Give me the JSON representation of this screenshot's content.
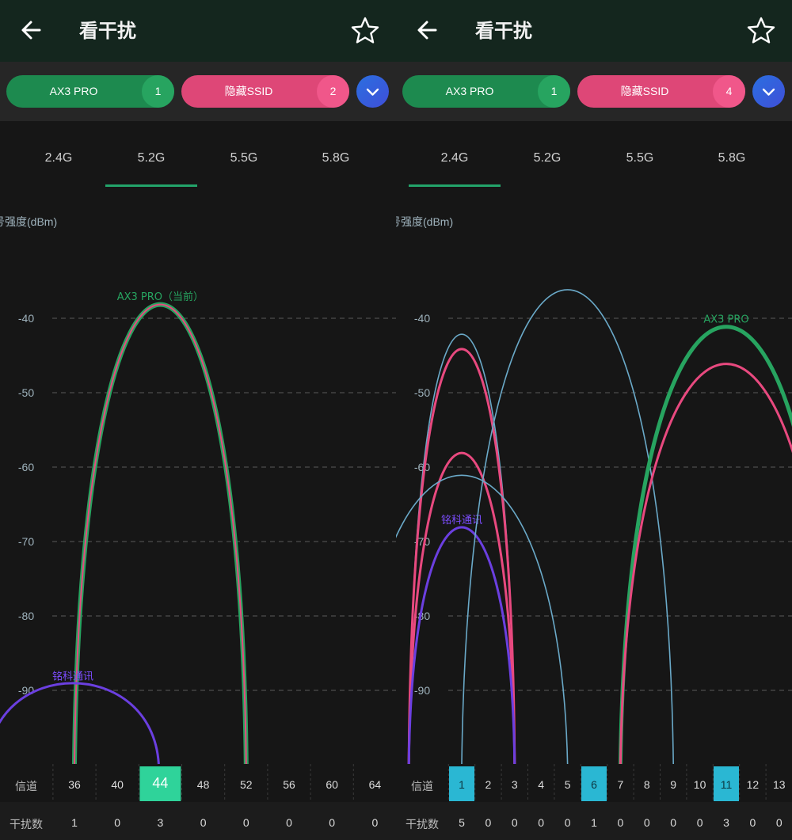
{
  "colors": {
    "header_bg": "#14261e",
    "green": "#1d8a4f",
    "pink": "#de4777",
    "blue_curve": "#6aa9c8",
    "purple": "#6b3fe0",
    "selected_channel_bg": "#2fd39a",
    "highlight_channel_bg": "#2ab7d3"
  },
  "panels": [
    {
      "header": {
        "title": "看干扰"
      },
      "chips": [
        {
          "label": "AX3 PRO",
          "count": "1"
        },
        {
          "label": "隐藏SSID",
          "count": "2"
        }
      ],
      "tabs": [
        "2.4G",
        "5.2G",
        "5.5G",
        "5.8G"
      ],
      "active_tab": 1,
      "y_axis_label": "号强度(dBm)",
      "channel_row_label": "信道",
      "interference_row_label": "干扰数",
      "chart_data": {
        "type": "line",
        "ylabel": "强度(dBm)",
        "ylim": [
          -100,
          -35
        ],
        "y_ticks": [
          "-40",
          "-50",
          "-60",
          "-70",
          "-80",
          "-90"
        ],
        "channels": [
          "36",
          "40",
          "44",
          "48",
          "52",
          "56",
          "60",
          "64"
        ],
        "interference": [
          "1",
          "0",
          "3",
          "0",
          "0",
          "0",
          "0",
          "0"
        ],
        "selected_channel": "44",
        "series": [
          {
            "name": "AX3 PRO（当前）",
            "center": 44,
            "width": 16,
            "peak": -38,
            "style": "green-pink",
            "labeled": true
          },
          {
            "name": "铭科通讯",
            "center": 44,
            "width": 16,
            "peak": -89,
            "offset": -6,
            "style": "purple",
            "labeled": true
          }
        ]
      }
    },
    {
      "header": {
        "title": "看干扰"
      },
      "chips": [
        {
          "label": "AX3 PRO",
          "count": "1"
        },
        {
          "label": "隐藏SSID",
          "count": "4"
        }
      ],
      "tabs": [
        "2.4G",
        "5.2G",
        "5.5G",
        "5.8G"
      ],
      "active_tab": 0,
      "y_axis_label": "号强度(dBm)",
      "channel_row_label": "信道",
      "interference_row_label": "干扰数",
      "chart_data": {
        "type": "line",
        "ylabel": "强度(dBm)",
        "ylim": [
          -100,
          -35
        ],
        "y_ticks": [
          "-40",
          "-50",
          "-60",
          "-70",
          "-80",
          "-90"
        ],
        "channels": [
          "1",
          "2",
          "3",
          "4",
          "5",
          "6",
          "7",
          "8",
          "9",
          "10",
          "11",
          "12",
          "13"
        ],
        "interference": [
          "5",
          "0",
          "0",
          "0",
          "0",
          "1",
          "0",
          "0",
          "0",
          "0",
          "3",
          "0",
          "0"
        ],
        "highlight_channels": [
          "1",
          "6",
          "11"
        ],
        "series": [
          {
            "name": "隐藏SSID",
            "center": 1,
            "width": 4,
            "peak": -42,
            "style": "blue"
          },
          {
            "name": "隐藏SSID",
            "center": 1,
            "width": 4,
            "peak": -44,
            "style": "pink"
          },
          {
            "name": "隐藏SSID",
            "center": 1,
            "width": 4,
            "peak": -58,
            "style": "pink"
          },
          {
            "name": "隐藏SSID",
            "center": 1,
            "width": 8,
            "peak": -61,
            "style": "blue"
          },
          {
            "name": "铭科通讯",
            "center": 1,
            "width": 4,
            "peak": -68,
            "style": "purple",
            "labeled": true
          },
          {
            "name": "隐藏SSID",
            "center": 5,
            "width": 8,
            "peak": -36,
            "style": "blue"
          },
          {
            "name": "AX3 PRO",
            "center": 11,
            "width": 8,
            "peak": -41,
            "style": "green",
            "labeled": true
          },
          {
            "name": "隐藏SSID",
            "center": 11,
            "width": 8,
            "peak": -46,
            "style": "pink"
          }
        ]
      }
    }
  ]
}
